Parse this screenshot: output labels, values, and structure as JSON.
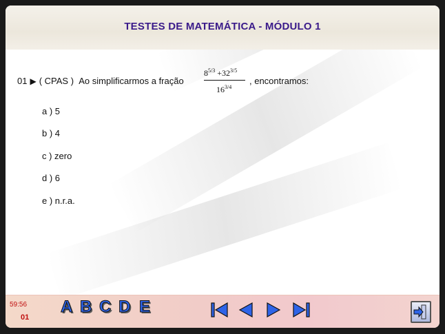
{
  "header": {
    "title": "TESTES DE MATEMÁTICA - MÓDULO 1"
  },
  "question": {
    "number": "01",
    "arrow": "▶",
    "source": "( CPAS )",
    "text": "Ao simplificarmos a fração",
    "after": ", encontramos:",
    "fraction": {
      "num_base1": "8",
      "num_exp1": "5/3",
      "plus": "+",
      "num_base2": "32",
      "num_exp2": "3/5",
      "den_base": "16",
      "den_exp": "3/4"
    }
  },
  "options": [
    {
      "label": "a ) 5"
    },
    {
      "label": "b ) 4"
    },
    {
      "label": "c ) zero"
    },
    {
      "label": "d ) 6"
    },
    {
      "label": "e ) n.r.a."
    }
  ],
  "footer": {
    "timer": "59:56",
    "question_number": "01",
    "answer_buttons": [
      "A",
      "B",
      "C",
      "D",
      "E"
    ],
    "colors": {
      "letter": "#2e64e8",
      "nav": "#2e64e8",
      "counter": "#c01010"
    },
    "nav_icons": [
      "first-icon",
      "previous-icon",
      "next-icon",
      "last-icon"
    ],
    "exit_icon": "exit-icon"
  }
}
